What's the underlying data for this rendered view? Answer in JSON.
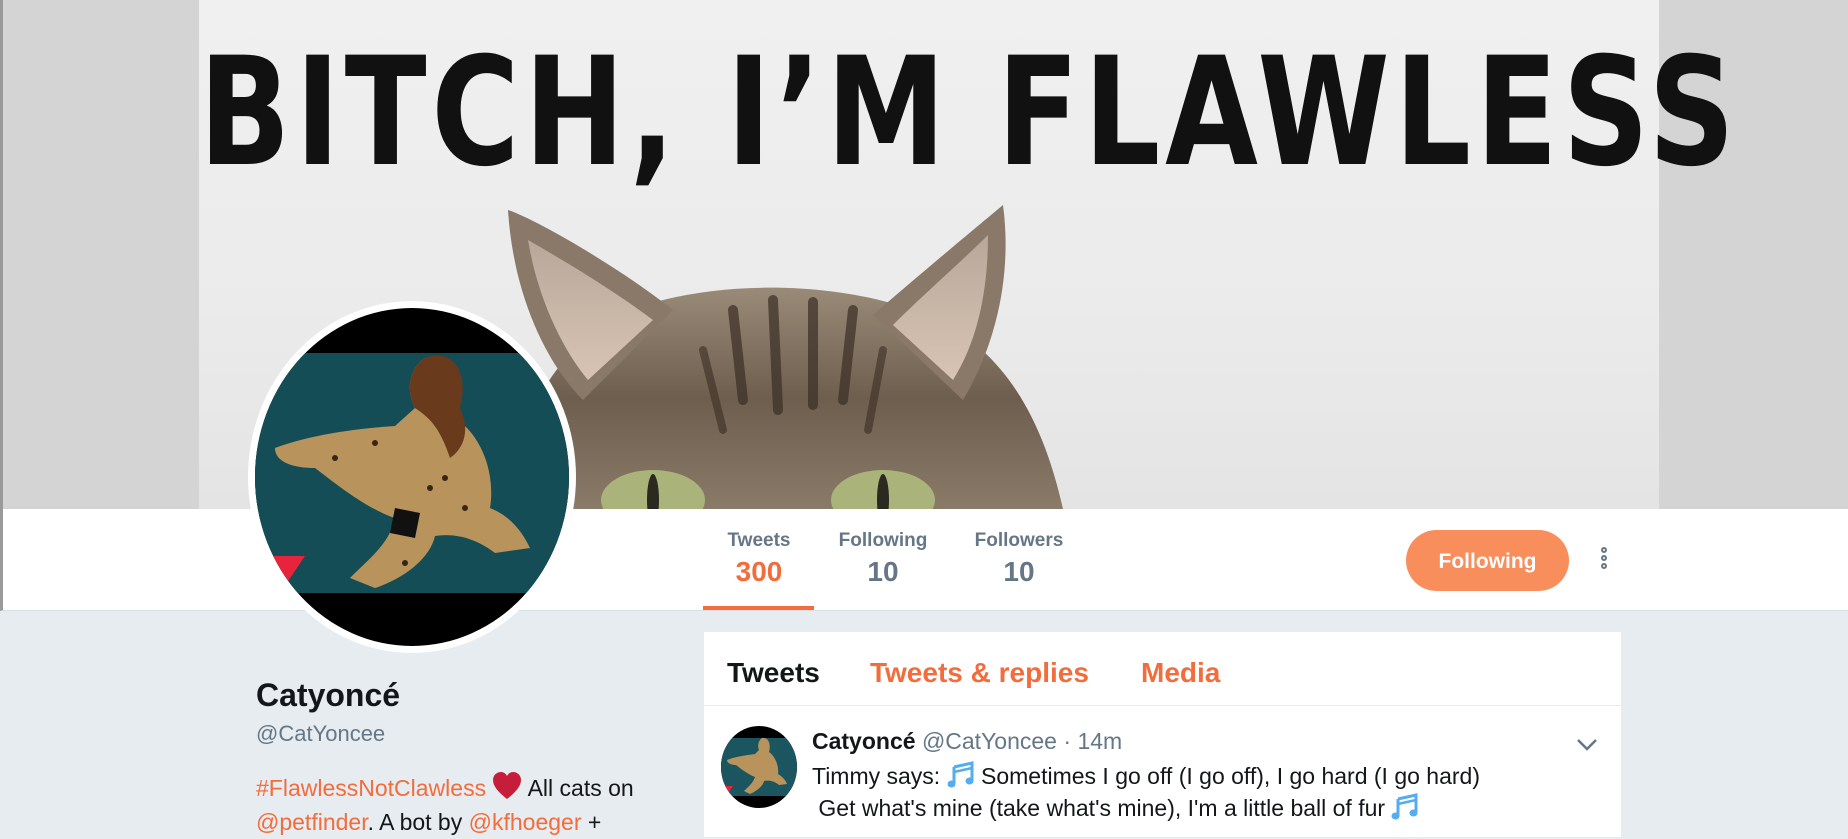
{
  "banner": {
    "headline": "BITCH, I’M FLAWLESS"
  },
  "profile_nav": {
    "stats": [
      {
        "label": "Tweets",
        "value": "300"
      },
      {
        "label": "Following",
        "value": "10"
      },
      {
        "label": "Followers",
        "value": "10"
      }
    ],
    "follow_button": "Following",
    "more_icon": "more-vertical-icon"
  },
  "profile": {
    "name": "Catyoncé",
    "handle": "@CatYoncee",
    "bio": {
      "hashtag": "#FlawlessNotClawless",
      "text1": "All cats on",
      "mention1": "@petfinder",
      "text2": ". A bot by",
      "mention2": "@kfhoeger",
      "text3": "+"
    }
  },
  "timeline": {
    "tabs": [
      "Tweets",
      "Tweets & replies",
      "Media"
    ],
    "tweet": {
      "name": "Catyoncé",
      "handle": "@CatYoncee",
      "separator": "·",
      "time": "14m",
      "line1_prefix": "Timmy says:",
      "line1_text": "Sometimes I go off (I go off), I go hard (I go hard)",
      "line2_text": "Get what's mine (take what's mine), I'm a little ball of fur"
    }
  },
  "colors": {
    "accent": "#f26c3c",
    "button": "#f88e5c",
    "muted": "#657786",
    "text": "#14171a",
    "music_note": "#55acee"
  }
}
